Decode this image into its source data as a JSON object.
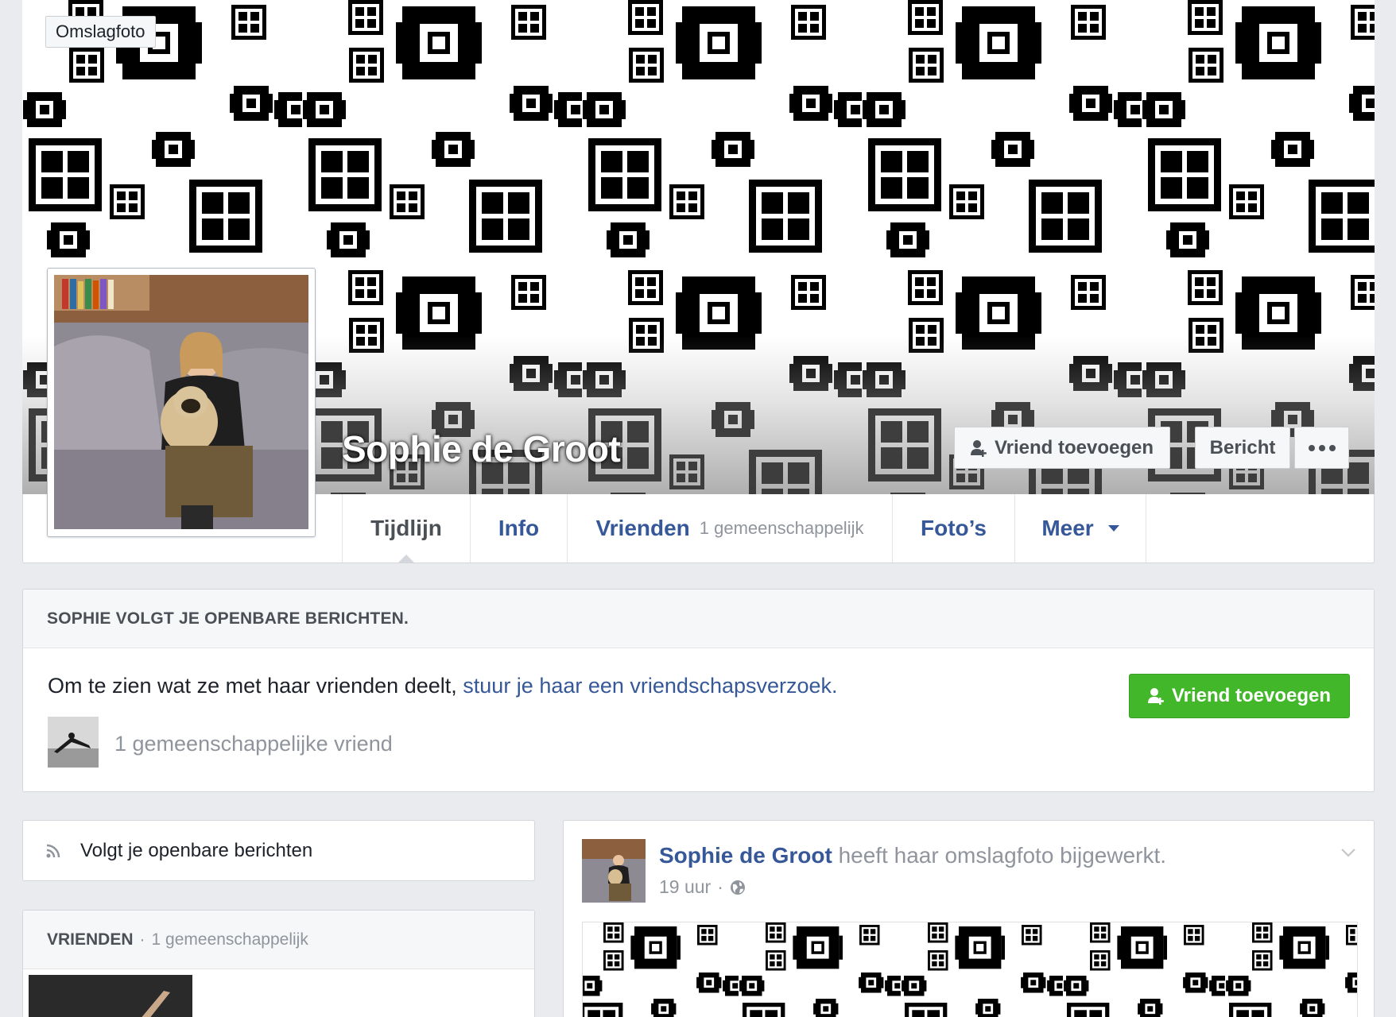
{
  "cover": {
    "label": "Omslagfoto"
  },
  "profile": {
    "name": "Sophie de Groot"
  },
  "actions": {
    "add_friend": "Vriend toevoegen",
    "message": "Bericht"
  },
  "tabs": [
    {
      "label": "Tijdlijn"
    },
    {
      "label": "Info"
    },
    {
      "label": "Vrienden",
      "sub": "1 gemeenschappelijk"
    },
    {
      "label": "Foto’s"
    },
    {
      "label": "Meer"
    }
  ],
  "notice": {
    "heading": "SOPHIE VOLGT JE OPENBARE BERICHTEN.",
    "text": "Om te zien wat ze met haar vrienden deelt,",
    "link": "stuur je haar een vriendschapsverzoek.",
    "button": "Vriend toevoegen",
    "mutual": "1 gemeenschappelijke vriend"
  },
  "follow": {
    "label": "Volgt je openbare berichten"
  },
  "friends": {
    "heading": "VRIENDEN",
    "separator": "·",
    "count": "1 gemeenschappelijk"
  },
  "post": {
    "author": "Sophie de Groot",
    "action": "heeft haar omslagfoto bijgewerkt.",
    "time": "19 uur",
    "separator": "·"
  },
  "colors": {
    "link": "#365899",
    "green_button": "#42b72a",
    "page_bg": "#e9ebee"
  },
  "icons": [
    "add-friend-icon",
    "more-icon",
    "caret-down-icon",
    "rss-icon",
    "globe-icon",
    "chevron-down-icon"
  ]
}
